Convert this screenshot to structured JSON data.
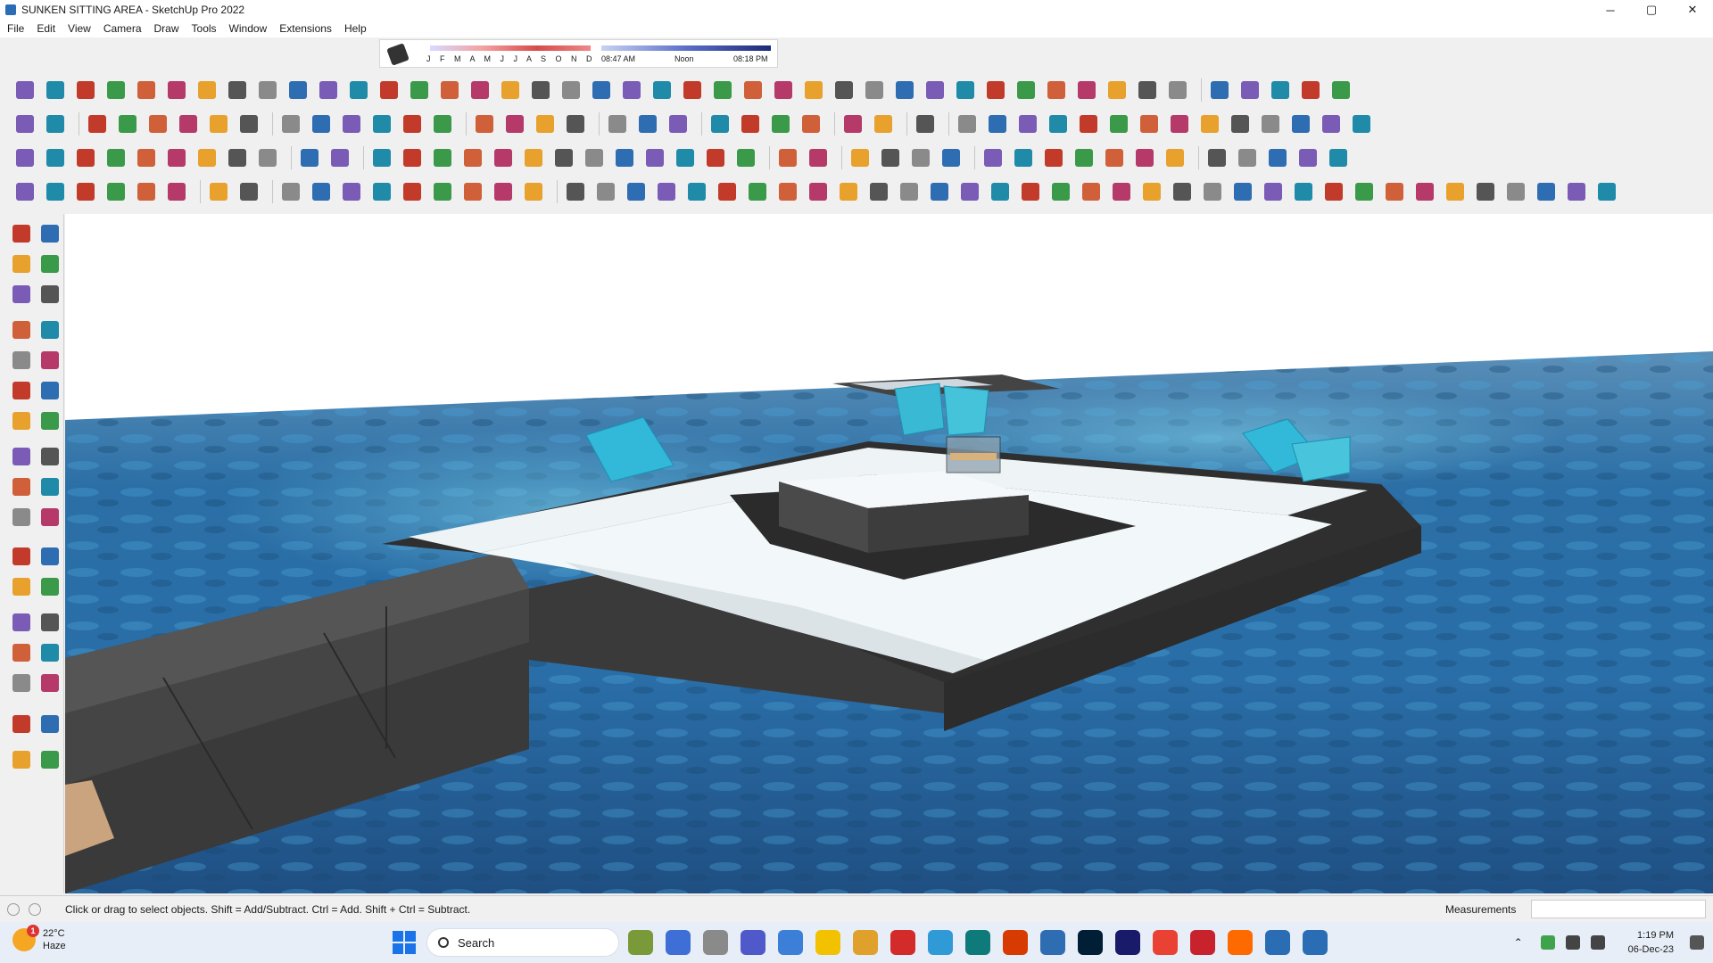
{
  "window": {
    "title": "SUNKEN SITTING AREA - SketchUp Pro 2022",
    "controls": [
      "─",
      "▢",
      "✕"
    ]
  },
  "menu": [
    "File",
    "Edit",
    "View",
    "Camera",
    "Draw",
    "Tools",
    "Window",
    "Extensions",
    "Help"
  ],
  "shadows": {
    "months": "J F M A M J J A S O N D",
    "time_start": "08:47 AM",
    "time_mid": "Noon",
    "time_end": "08:18 PM"
  },
  "colors": {
    "water_dark": "#1f4f82",
    "water_light": "#3f90c8",
    "deck_grey": "#3e3e3e",
    "cushion_white": "#eef3f5",
    "pillow_cyan": "#32b8d8"
  },
  "status": {
    "hint": "Click or drag to select objects. Shift = Add/Subtract. Ctrl = Add. Shift + Ctrl = Subtract.",
    "measurements_label": "Measurements",
    "measurements_value": ""
  },
  "taskbar": {
    "weather_temp": "22°C",
    "weather_desc": "Haze",
    "weather_badge": "1",
    "search_placeholder": "Search",
    "time": "1:19 PM",
    "date": "06-Dec-23"
  }
}
